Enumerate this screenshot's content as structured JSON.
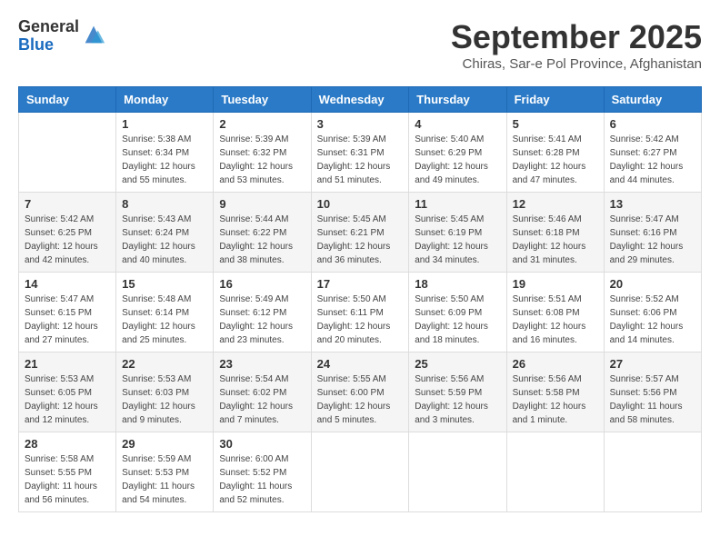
{
  "header": {
    "logo_general": "General",
    "logo_blue": "Blue",
    "month_title": "September 2025",
    "location": "Chiras, Sar-e Pol Province, Afghanistan"
  },
  "days_of_week": [
    "Sunday",
    "Monday",
    "Tuesday",
    "Wednesday",
    "Thursday",
    "Friday",
    "Saturday"
  ],
  "weeks": [
    [
      {
        "day": "",
        "info": ""
      },
      {
        "day": "1",
        "info": "Sunrise: 5:38 AM\nSunset: 6:34 PM\nDaylight: 12 hours\nand 55 minutes."
      },
      {
        "day": "2",
        "info": "Sunrise: 5:39 AM\nSunset: 6:32 PM\nDaylight: 12 hours\nand 53 minutes."
      },
      {
        "day": "3",
        "info": "Sunrise: 5:39 AM\nSunset: 6:31 PM\nDaylight: 12 hours\nand 51 minutes."
      },
      {
        "day": "4",
        "info": "Sunrise: 5:40 AM\nSunset: 6:29 PM\nDaylight: 12 hours\nand 49 minutes."
      },
      {
        "day": "5",
        "info": "Sunrise: 5:41 AM\nSunset: 6:28 PM\nDaylight: 12 hours\nand 47 minutes."
      },
      {
        "day": "6",
        "info": "Sunrise: 5:42 AM\nSunset: 6:27 PM\nDaylight: 12 hours\nand 44 minutes."
      }
    ],
    [
      {
        "day": "7",
        "info": "Sunrise: 5:42 AM\nSunset: 6:25 PM\nDaylight: 12 hours\nand 42 minutes."
      },
      {
        "day": "8",
        "info": "Sunrise: 5:43 AM\nSunset: 6:24 PM\nDaylight: 12 hours\nand 40 minutes."
      },
      {
        "day": "9",
        "info": "Sunrise: 5:44 AM\nSunset: 6:22 PM\nDaylight: 12 hours\nand 38 minutes."
      },
      {
        "day": "10",
        "info": "Sunrise: 5:45 AM\nSunset: 6:21 PM\nDaylight: 12 hours\nand 36 minutes."
      },
      {
        "day": "11",
        "info": "Sunrise: 5:45 AM\nSunset: 6:19 PM\nDaylight: 12 hours\nand 34 minutes."
      },
      {
        "day": "12",
        "info": "Sunrise: 5:46 AM\nSunset: 6:18 PM\nDaylight: 12 hours\nand 31 minutes."
      },
      {
        "day": "13",
        "info": "Sunrise: 5:47 AM\nSunset: 6:16 PM\nDaylight: 12 hours\nand 29 minutes."
      }
    ],
    [
      {
        "day": "14",
        "info": "Sunrise: 5:47 AM\nSunset: 6:15 PM\nDaylight: 12 hours\nand 27 minutes."
      },
      {
        "day": "15",
        "info": "Sunrise: 5:48 AM\nSunset: 6:14 PM\nDaylight: 12 hours\nand 25 minutes."
      },
      {
        "day": "16",
        "info": "Sunrise: 5:49 AM\nSunset: 6:12 PM\nDaylight: 12 hours\nand 23 minutes."
      },
      {
        "day": "17",
        "info": "Sunrise: 5:50 AM\nSunset: 6:11 PM\nDaylight: 12 hours\nand 20 minutes."
      },
      {
        "day": "18",
        "info": "Sunrise: 5:50 AM\nSunset: 6:09 PM\nDaylight: 12 hours\nand 18 minutes."
      },
      {
        "day": "19",
        "info": "Sunrise: 5:51 AM\nSunset: 6:08 PM\nDaylight: 12 hours\nand 16 minutes."
      },
      {
        "day": "20",
        "info": "Sunrise: 5:52 AM\nSunset: 6:06 PM\nDaylight: 12 hours\nand 14 minutes."
      }
    ],
    [
      {
        "day": "21",
        "info": "Sunrise: 5:53 AM\nSunset: 6:05 PM\nDaylight: 12 hours\nand 12 minutes."
      },
      {
        "day": "22",
        "info": "Sunrise: 5:53 AM\nSunset: 6:03 PM\nDaylight: 12 hours\nand 9 minutes."
      },
      {
        "day": "23",
        "info": "Sunrise: 5:54 AM\nSunset: 6:02 PM\nDaylight: 12 hours\nand 7 minutes."
      },
      {
        "day": "24",
        "info": "Sunrise: 5:55 AM\nSunset: 6:00 PM\nDaylight: 12 hours\nand 5 minutes."
      },
      {
        "day": "25",
        "info": "Sunrise: 5:56 AM\nSunset: 5:59 PM\nDaylight: 12 hours\nand 3 minutes."
      },
      {
        "day": "26",
        "info": "Sunrise: 5:56 AM\nSunset: 5:58 PM\nDaylight: 12 hours\nand 1 minute."
      },
      {
        "day": "27",
        "info": "Sunrise: 5:57 AM\nSunset: 5:56 PM\nDaylight: 11 hours\nand 58 minutes."
      }
    ],
    [
      {
        "day": "28",
        "info": "Sunrise: 5:58 AM\nSunset: 5:55 PM\nDaylight: 11 hours\nand 56 minutes."
      },
      {
        "day": "29",
        "info": "Sunrise: 5:59 AM\nSunset: 5:53 PM\nDaylight: 11 hours\nand 54 minutes."
      },
      {
        "day": "30",
        "info": "Sunrise: 6:00 AM\nSunset: 5:52 PM\nDaylight: 11 hours\nand 52 minutes."
      },
      {
        "day": "",
        "info": ""
      },
      {
        "day": "",
        "info": ""
      },
      {
        "day": "",
        "info": ""
      },
      {
        "day": "",
        "info": ""
      }
    ]
  ]
}
